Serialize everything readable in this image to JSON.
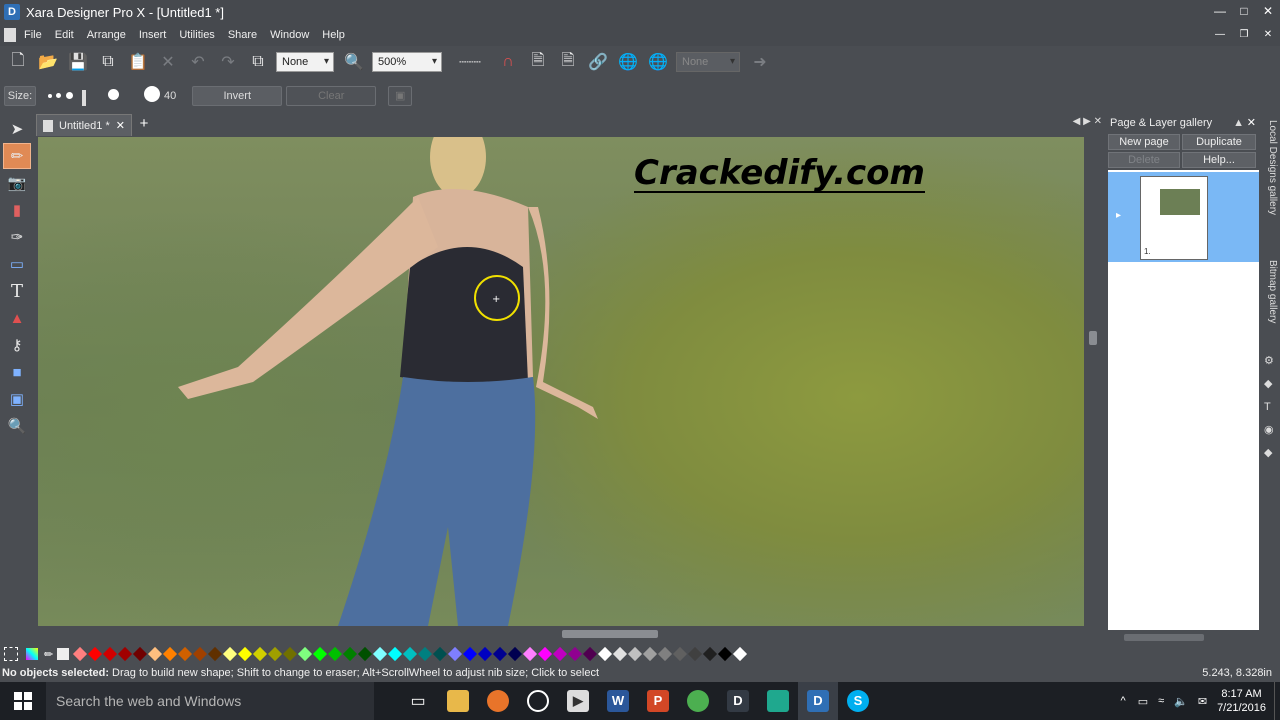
{
  "window": {
    "title": "Xara Designer Pro X - [Untitled1 *]"
  },
  "menu": [
    "File",
    "Edit",
    "Arrange",
    "Insert",
    "Utilities",
    "Share",
    "Window",
    "Help"
  ],
  "toolbar": {
    "feather_value": "None",
    "zoom_value": "500%",
    "disabled_field": "None"
  },
  "eraser_bar": {
    "size_label": "Size:",
    "size_value": "40",
    "invert_label": "Invert",
    "clear_label": "Clear"
  },
  "document_tab": {
    "label": "Untitled1 *"
  },
  "canvas": {
    "watermark": "Crackedify.com"
  },
  "gallery": {
    "title": "Page & Layer gallery",
    "new_page": "New page",
    "duplicate": "Duplicate",
    "delete": "Delete",
    "help": "Help...",
    "page_label": "1."
  },
  "side_tabs": [
    "Local Designs gallery",
    "Bitmap gallery"
  ],
  "palette_colors": [
    "#ff7f7f",
    "#ff0000",
    "#d00000",
    "#a00000",
    "#700000",
    "#ffbf7f",
    "#ff8000",
    "#d06000",
    "#a04000",
    "#603000",
    "#ffff7f",
    "#ffff00",
    "#d0d000",
    "#a0a000",
    "#707000",
    "#7fff7f",
    "#00ff00",
    "#00c000",
    "#008000",
    "#005000",
    "#7fffff",
    "#00ffff",
    "#00c0c0",
    "#008080",
    "#005050",
    "#7f7fff",
    "#0000ff",
    "#0000c0",
    "#000090",
    "#000050",
    "#ff7fff",
    "#ff00ff",
    "#c000c0",
    "#900090",
    "#500050",
    "#ffffff",
    "#e0e0e0",
    "#c0c0c0",
    "#a0a0a0",
    "#808080",
    "#606060",
    "#404040",
    "#202020",
    "#000000",
    "#ffffff"
  ],
  "status": {
    "bold": "No objects selected:",
    "text": " Drag to build new shape; Shift to change to eraser; Alt+ScrollWheel to adjust nib size; Click to select",
    "coords": "5.243, 8.328in"
  },
  "taskbar": {
    "search_placeholder": "Search the web and Windows",
    "time": "8:17 AM",
    "date": "7/21/2016"
  }
}
